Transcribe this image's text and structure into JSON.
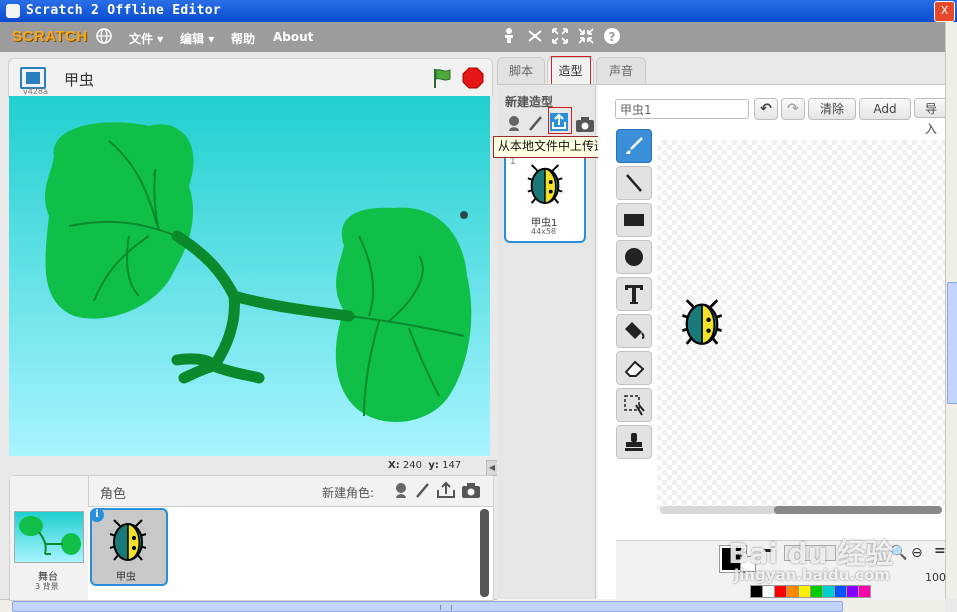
{
  "window": {
    "title": "Scratch 2 Offline Editor",
    "close_label": "X"
  },
  "menubar": {
    "logo": "SCRATCH",
    "items": [
      {
        "label": "文件"
      },
      {
        "label": "编辑"
      },
      {
        "label": "帮助"
      },
      {
        "label": "About"
      }
    ]
  },
  "stage": {
    "version": "v428a",
    "sprite_name": "甲虫",
    "coords": {
      "x_label": "X:",
      "x": "240",
      "y_label": "y:",
      "y": "147"
    }
  },
  "sprites_panel": {
    "heading": "角色",
    "new_sprite_label": "新建角色:",
    "stage_label": "舞台",
    "stage_backdrops": "3 背景",
    "sprites": [
      {
        "name": "甲虫"
      }
    ]
  },
  "tabs": [
    {
      "label": "脚本"
    },
    {
      "label": "造型"
    },
    {
      "label": "声音"
    }
  ],
  "costumes_panel": {
    "new_costume_label": "新建造型",
    "tooltip": "从本地文件中上传造型",
    "costumes": [
      {
        "number": "1",
        "name": "甲虫1",
        "size": "44x58"
      }
    ]
  },
  "paint_editor": {
    "costume_name": "甲虫1",
    "clear_label": "清除",
    "add_label": "Add",
    "import_label": "导入",
    "zoom_level": "100",
    "tools": [
      "brush-icon",
      "line-icon",
      "rectangle-icon",
      "ellipse-icon",
      "text-icon",
      "fill-icon",
      "eraser-icon",
      "select-icon",
      "stamp-icon"
    ],
    "palette": [
      "#000000",
      "#ffffff",
      "#ff0000",
      "#ff8800",
      "#ffee00",
      "#00cc00",
      "#00cccc",
      "#0055ff",
      "#8800ff",
      "#ff00aa"
    ]
  },
  "watermark": {
    "text": "Bai du 经验",
    "url": "jingyan.baidu.com"
  }
}
